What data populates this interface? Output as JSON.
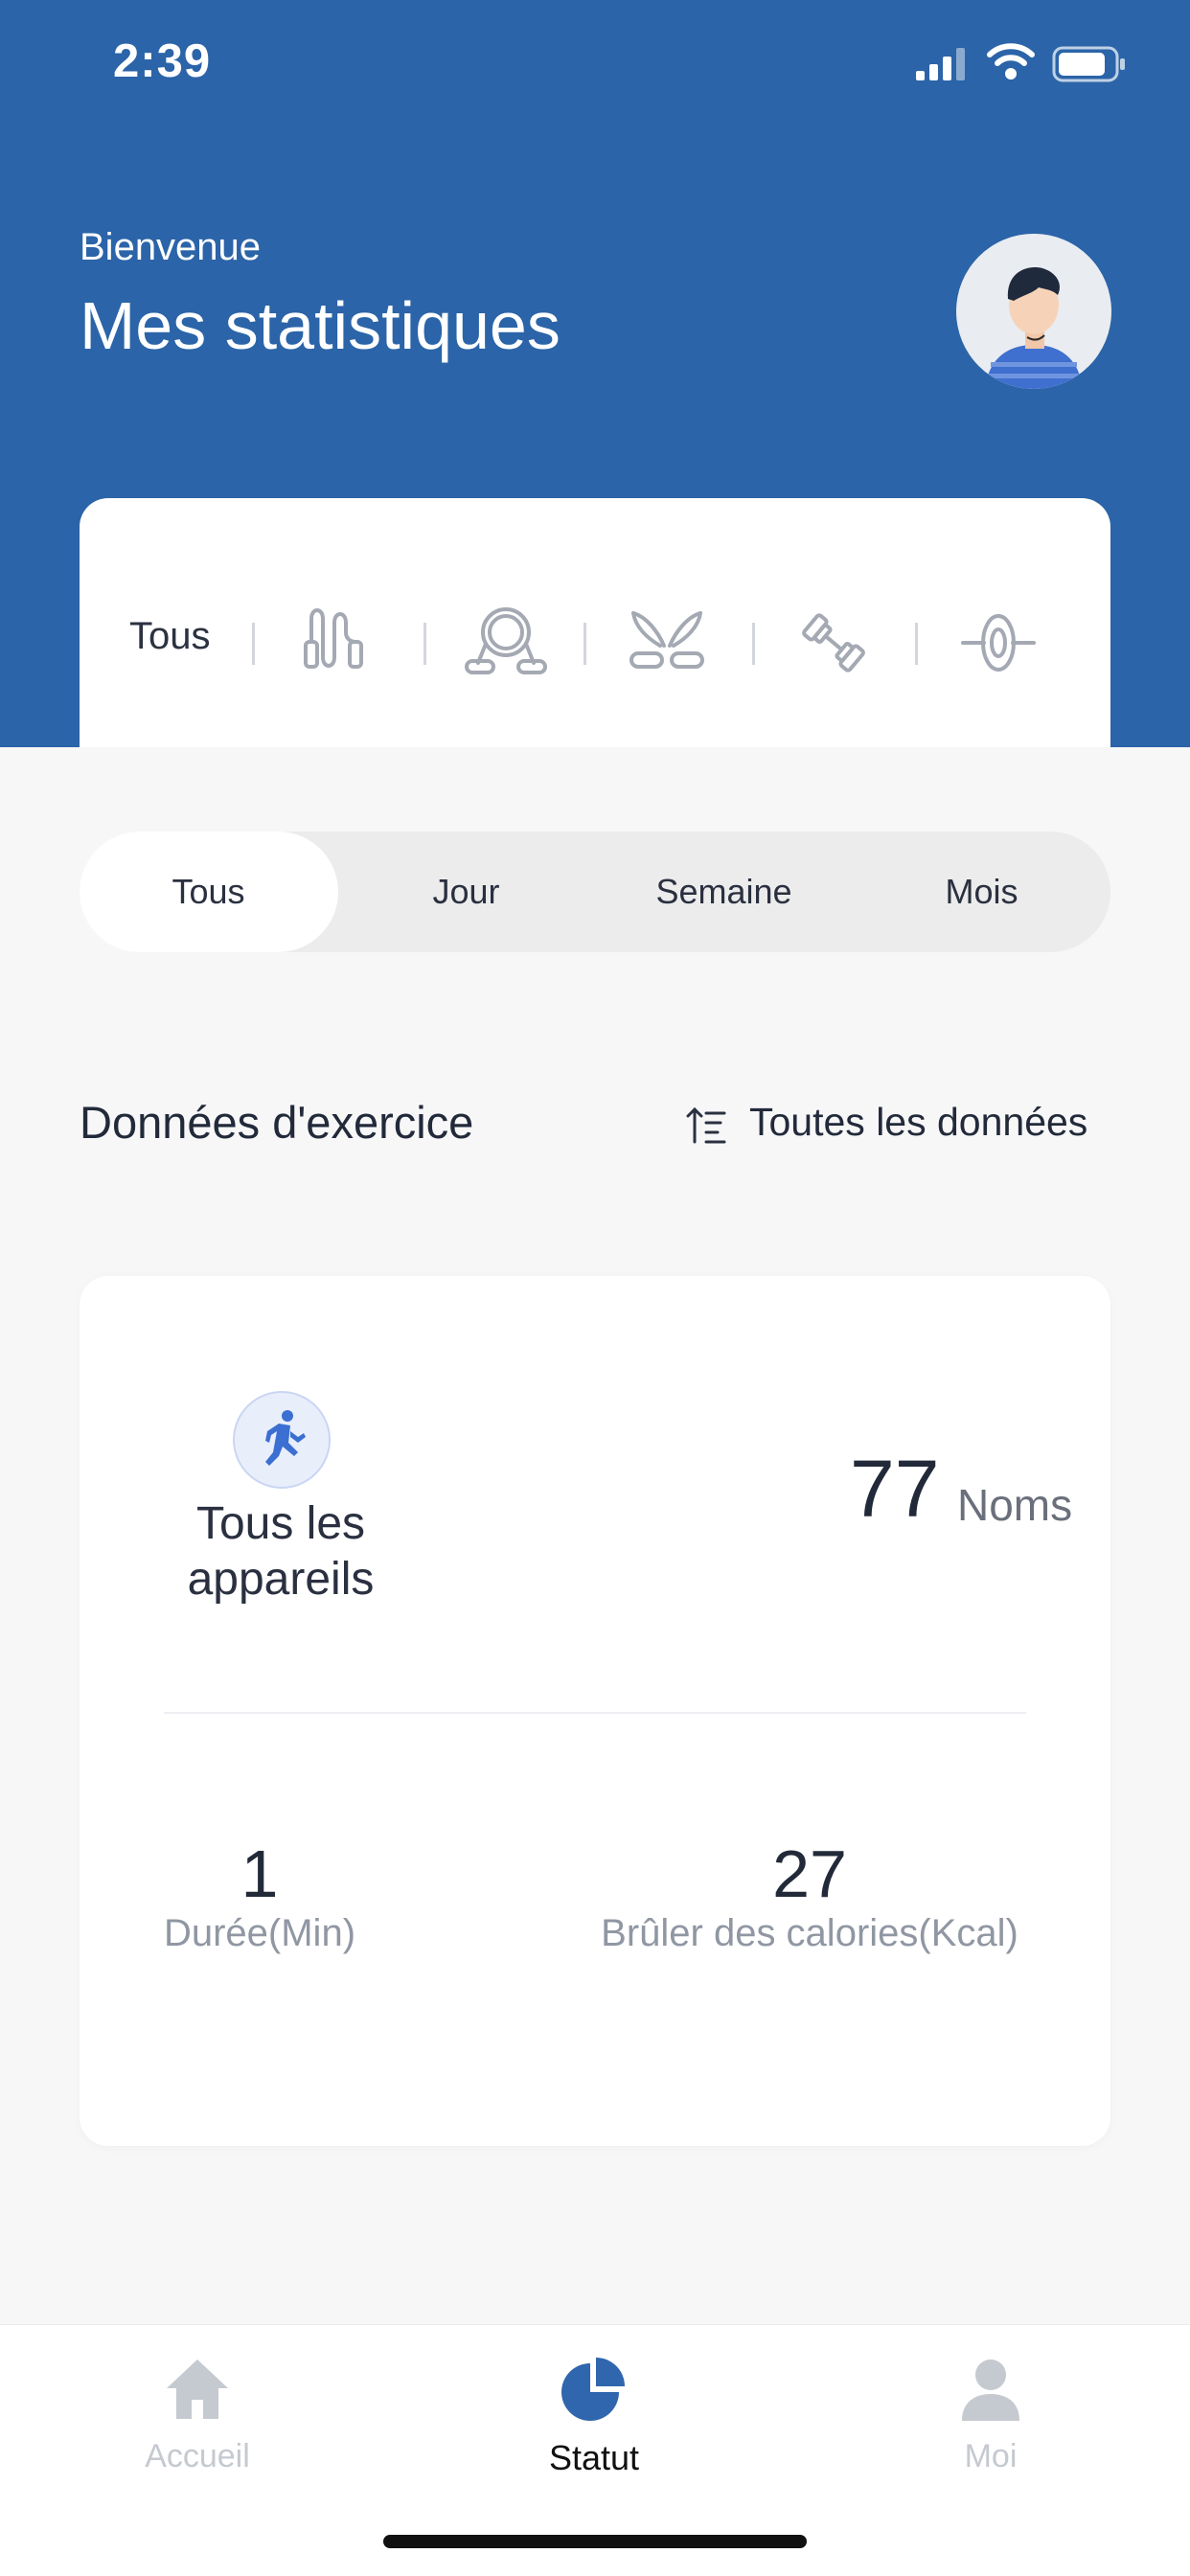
{
  "status_bar": {
    "time": "2:39"
  },
  "header": {
    "welcome": "Bienvenue",
    "title": "Mes statistiques"
  },
  "devices": {
    "all_label": "Tous",
    "icons": [
      "jump-rope-icon",
      "pull-rope-icon",
      "grip-trainer-icon",
      "dumbbell-icon",
      "ab-wheel-icon"
    ]
  },
  "period_tabs": {
    "items": [
      "Tous",
      "Jour",
      "Semaine",
      "Mois"
    ],
    "selected": "Tous"
  },
  "section": {
    "title": "Données d'exercice",
    "all_data": "Toutes les données"
  },
  "stats": {
    "device_name": "Tous les appareils",
    "count_value": "77",
    "count_unit": "Noms",
    "duration_value": "1",
    "duration_label": "Durée(Min)",
    "calories_value": "27",
    "calories_label": "Brûler des calories(Kcal)"
  },
  "tabbar": {
    "items": [
      {
        "label": "Accueil",
        "icon": "home-icon",
        "active": false
      },
      {
        "label": "Statut",
        "icon": "pie-chart-icon",
        "active": true
      },
      {
        "label": "Moi",
        "icon": "person-icon",
        "active": false
      }
    ]
  },
  "colors": {
    "brand": "#2b64a8",
    "active_icon": "#2f66ad",
    "inactive": "#c5c9d0",
    "background": "#f7f7f8"
  }
}
